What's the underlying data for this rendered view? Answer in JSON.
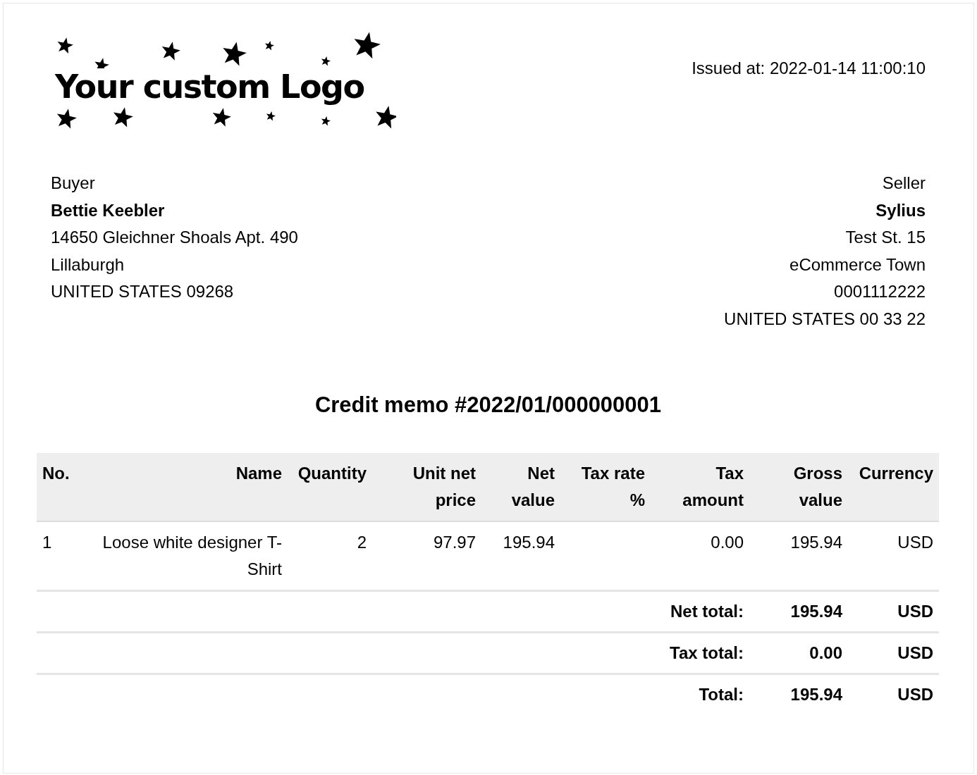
{
  "logo": {
    "text": "Your custom Logo"
  },
  "issued_at": "Issued at: 2022-01-14 11:00:10",
  "buyer": {
    "label": "Buyer",
    "name": "Bettie Keebler",
    "lines": [
      "14650 Gleichner Shoals Apt. 490",
      "Lillaburgh",
      "UNITED STATES 09268"
    ]
  },
  "seller": {
    "label": "Seller",
    "name": "Sylius",
    "lines": [
      "Test St. 15",
      "eCommerce Town",
      "0001112222",
      "UNITED STATES 00 33 22"
    ]
  },
  "title": "Credit memo #2022/01/000000001",
  "table": {
    "columns": [
      {
        "label": "No."
      },
      {
        "label": "Name"
      },
      {
        "label": "Quantity"
      },
      {
        "label": "Unit net price"
      },
      {
        "label": "Net value"
      },
      {
        "label": "Tax rate %"
      },
      {
        "label": "Tax amount"
      },
      {
        "label": "Gross value"
      },
      {
        "label": "Currency"
      }
    ],
    "rows": [
      {
        "cells": [
          "1",
          "Loose white designer T-Shirt",
          "2",
          "97.97",
          "195.94",
          "",
          "0.00",
          "195.94",
          "USD"
        ]
      }
    ],
    "totals": [
      {
        "label": "Net total:",
        "value": "195.94",
        "currency": "USD"
      },
      {
        "label": "Tax total:",
        "value": "0.00",
        "currency": "USD"
      },
      {
        "label": "Total:",
        "value": "195.94",
        "currency": "USD"
      }
    ]
  }
}
